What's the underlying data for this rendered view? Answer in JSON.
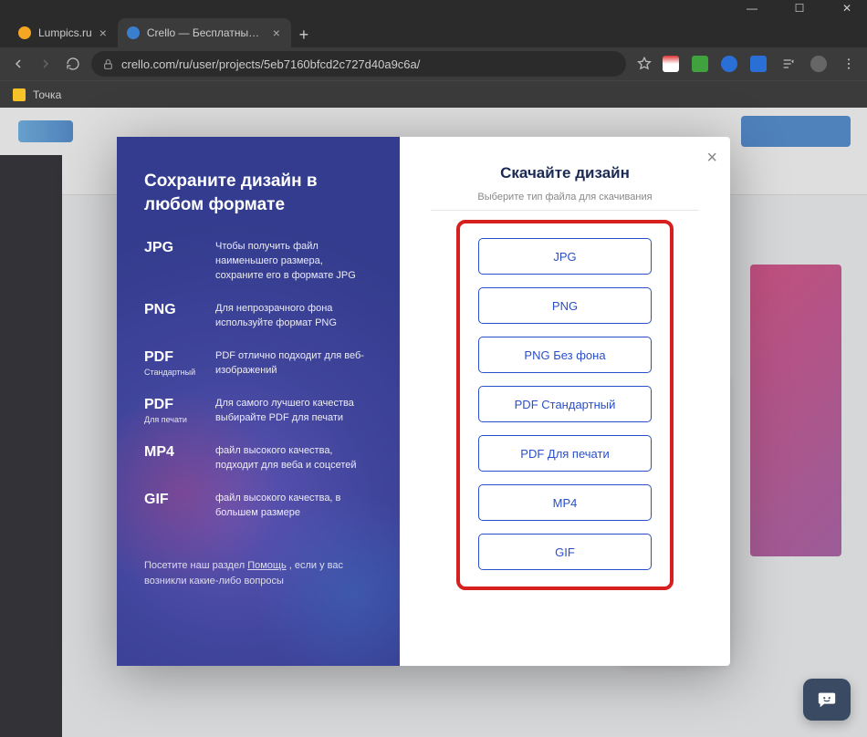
{
  "window": {
    "min": "—",
    "max": "☐",
    "close": "✕"
  },
  "tabs": [
    {
      "title": "Lumpics.ru",
      "faviconColor": "#f5a623"
    },
    {
      "title": "Crello — Бесплатный инструмен",
      "faviconColor": "#3a7fce"
    }
  ],
  "url": "crello.com/ru/user/projects/5eb7160bfcd2c727d40a9c6a/",
  "bookmarks": [
    {
      "label": "Точка"
    }
  ],
  "modal": {
    "left": {
      "heading": "Сохраните дизайн в любом формате",
      "formats": [
        {
          "code": "JPG",
          "sub": "",
          "desc": "Чтобы получить файл наименьшего размера, сохраните его в формате JPG"
        },
        {
          "code": "PNG",
          "sub": "",
          "desc": "Для непрозрачного фона используйте формат PNG"
        },
        {
          "code": "PDF",
          "sub": "Стандартный",
          "desc": "PDF отлично подходит для веб-изображений"
        },
        {
          "code": "PDF",
          "sub": "Для печати",
          "desc": "Для самого лучшего качества выбирайте PDF для печати"
        },
        {
          "code": "MP4",
          "sub": "",
          "desc": "файл высокого качества, подходит для веба и соцсетей"
        },
        {
          "code": "GIF",
          "sub": "",
          "desc": "файл высокого качества, в большем размере"
        }
      ],
      "help_pre": "Посетите наш раздел ",
      "help_link": "Помощь",
      "help_post": " , если у вас возникли какие-либо вопросы"
    },
    "right": {
      "heading": "Скачайте дизайн",
      "sub": "Выберите тип файла для скачивания",
      "buttons": [
        "JPG",
        "PNG",
        "PNG Без фона",
        "PDF Стандартный",
        "PDF Для печати",
        "MP4",
        "GIF"
      ]
    }
  }
}
